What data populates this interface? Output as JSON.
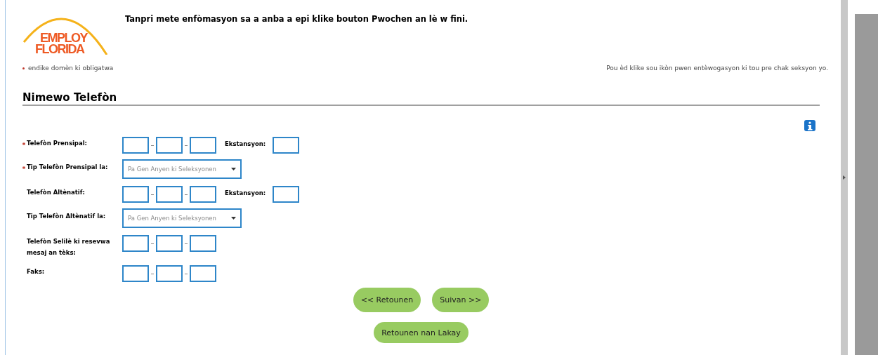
{
  "logo": {
    "line_1": "EMPLOY",
    "line_2": "FLORIDA"
  },
  "instruction": "Tanpri mete enfòmasyon sa a anba a epi klike bouton Pwochen an lè w fini.",
  "required_note": "endike domèn ki obligatwa",
  "help_note": "Pou èd klike sou ikòn pwen entèwogasyon ki tou pre chak seksyon yo.",
  "section": {
    "title": "Nimewo Telefòn"
  },
  "fields": [
    {
      "kind": "phone",
      "label": "Telefòn Prensipal:",
      "required": true,
      "extension_label": "Ekstansyon:"
    },
    {
      "kind": "select",
      "label": "Tip Telefòn Prensipal la:",
      "required": true,
      "placeholder": "Pa Gen Anyen ki Seleksyonen"
    },
    {
      "kind": "phone",
      "label": "Telefòn Altènatif:",
      "required": false,
      "extension_label": "Ekstansyon:"
    },
    {
      "kind": "select",
      "label": "Tip Telefòn Altènatif la:",
      "required": false,
      "placeholder": "Pa Gen Anyen ki Seleksyonen"
    },
    {
      "kind": "phone",
      "label": "Telefòn Selilè ki resevwa mesaj an tèks:",
      "required": false
    },
    {
      "kind": "phone",
      "label": "Faks:",
      "required": false
    }
  ],
  "buttons": [
    {
      "label": "<< Retounen"
    },
    {
      "label": "Suivan >>"
    },
    {
      "label": "Retounen nan Lakay"
    }
  ]
}
